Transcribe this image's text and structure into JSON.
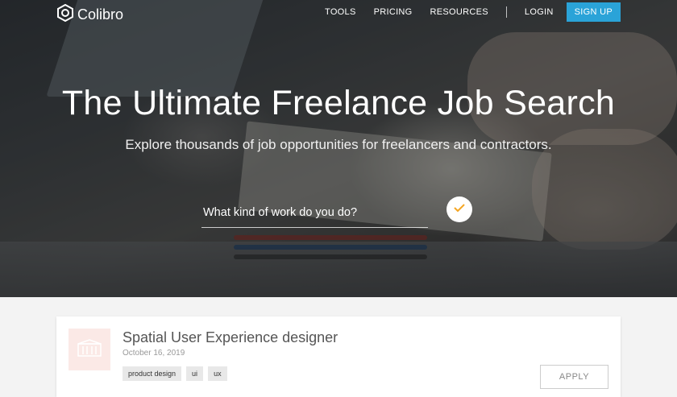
{
  "brand": {
    "name": "Colibro"
  },
  "nav": {
    "links": [
      "TOOLS",
      "PRICING",
      "RESOURCES"
    ],
    "login": "LOGIN",
    "signup": "SIGN UP"
  },
  "hero": {
    "title": "The Ultimate Freelance Job Search",
    "subtitle": "Explore thousands of job opportunities for freelancers and contractors.",
    "search_placeholder": "What kind of work do you do?"
  },
  "job": {
    "title": "Spatial User Experience designer",
    "date": "October 16, 2019",
    "tags": [
      "product design",
      "ui",
      "ux"
    ],
    "apply": "APPLY"
  },
  "colors": {
    "accent": "#2aa3d8",
    "check": "#f5a623"
  }
}
